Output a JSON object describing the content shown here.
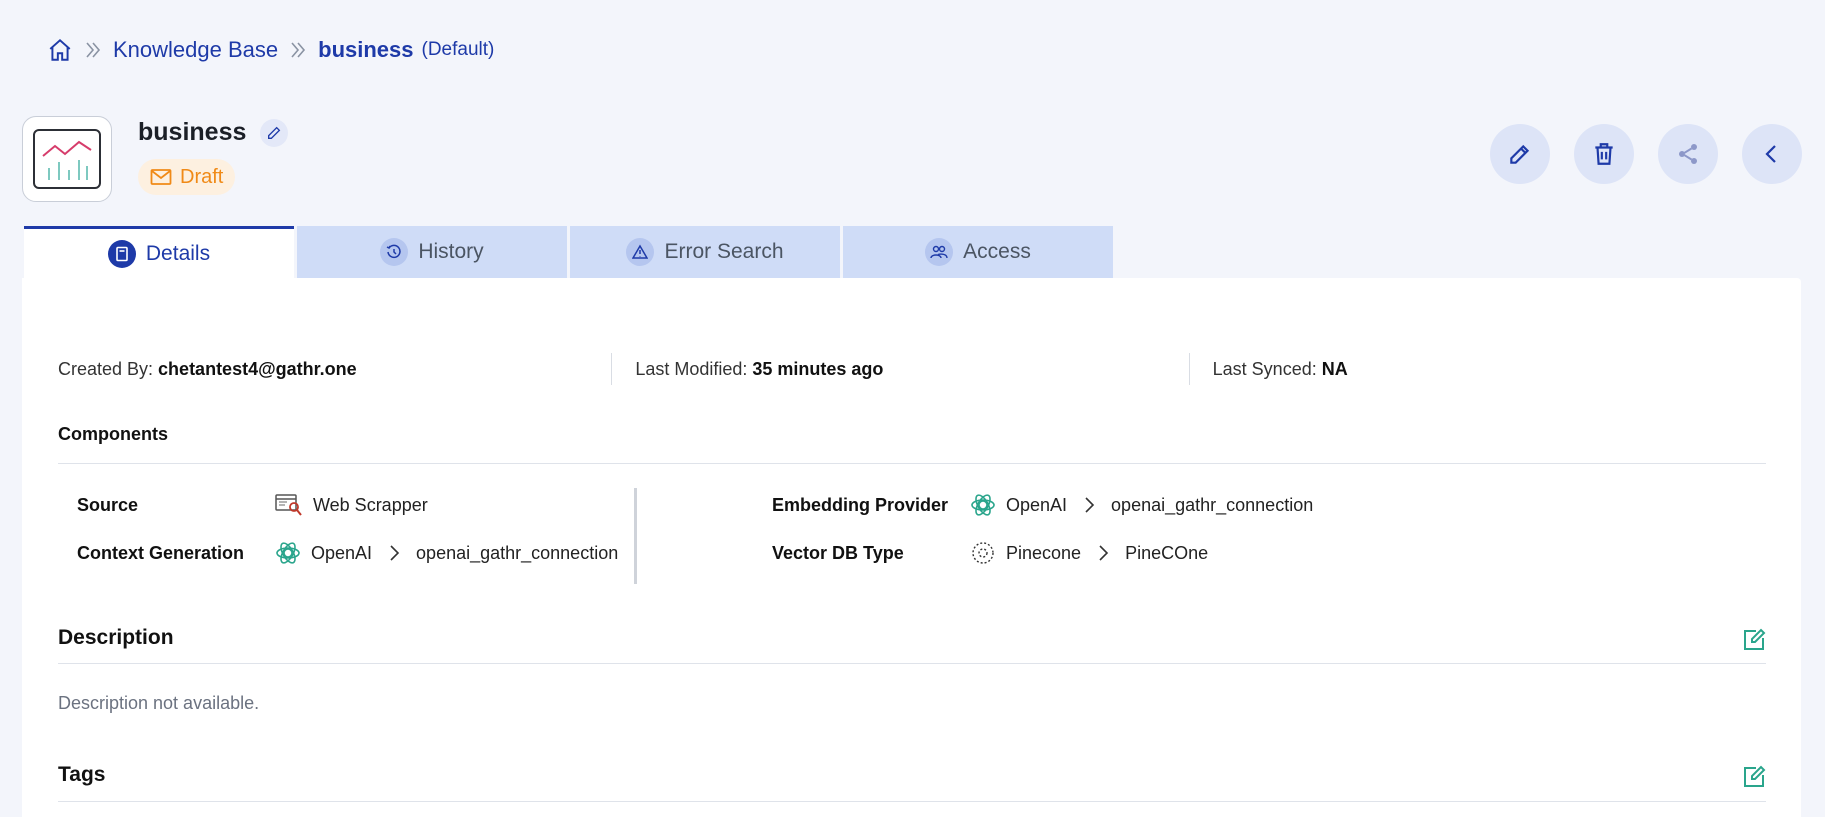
{
  "breadcrumb": {
    "home_icon": "home-icon",
    "items": [
      "Knowledge Base",
      "business"
    ],
    "default_label": "(Default)"
  },
  "header": {
    "title": "business",
    "status": "Draft",
    "colors": {
      "accent": "#1e3aa8",
      "draft": "#f08a17",
      "teal": "#2aa58c"
    }
  },
  "actions": [
    {
      "name": "edit",
      "icon": "pencil-icon"
    },
    {
      "name": "delete",
      "icon": "trash-icon"
    },
    {
      "name": "share",
      "icon": "share-icon"
    },
    {
      "name": "back",
      "icon": "chevron-left-icon"
    }
  ],
  "tabs": [
    "Details",
    "History",
    "Error Search",
    "Access"
  ],
  "meta": {
    "created_by_label": "Created By:",
    "created_by": "chetantest4@gathr.one",
    "modified_label": "Last Modified:",
    "modified": "35 minutes ago",
    "synced_label": "Last Synced:",
    "synced": "NA"
  },
  "components": {
    "title": "Components",
    "source_label": "Source",
    "source": "Web Scrapper",
    "context_label": "Context Generation",
    "context_provider": "OpenAI",
    "context_connection": "openai_gathr_connection",
    "embedding_label": "Embedding Provider",
    "embedding_provider": "OpenAI",
    "embedding_connection": "openai_gathr_connection",
    "vectordb_label": "Vector DB Type",
    "vectordb_provider": "Pinecone",
    "vectordb_connection": "PineCOne"
  },
  "description": {
    "title": "Description",
    "text": "Description not available."
  },
  "tags": {
    "title": "Tags"
  }
}
